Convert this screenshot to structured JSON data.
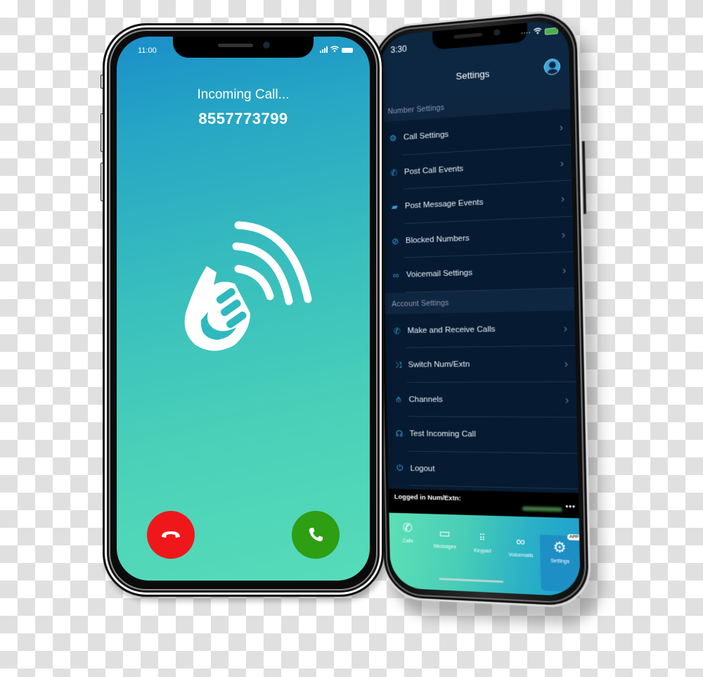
{
  "left_phone": {
    "status_time": "11:00",
    "status_icons": [
      "signal-icon",
      "wifi-icon",
      "battery-icon"
    ],
    "incoming_label": "Incoming Call...",
    "caller_number": "8557773799",
    "logo": "hand-wave-signal-logo",
    "decline_button": {
      "icon": "hang-up-icon",
      "color": "#f0171b"
    },
    "accept_button": {
      "icon": "phone-icon",
      "color": "#2e9e12"
    }
  },
  "right_phone": {
    "status_time": "3:30",
    "title": "Settings",
    "sections": [
      {
        "header": "Number Settings",
        "items": [
          {
            "label": "Call Settings",
            "icon": "gear-icon",
            "chevron": true
          },
          {
            "label": "Post Call Events",
            "icon": "phone-arrow-icon",
            "chevron": true
          },
          {
            "label": "Post Message Events",
            "icon": "message-icon",
            "chevron": true
          },
          {
            "label": "Blocked Numbers",
            "icon": "block-icon",
            "chevron": true
          },
          {
            "label": "Voicemail Settings",
            "icon": "voicemail-icon",
            "chevron": true
          }
        ]
      },
      {
        "header": "Account Settings",
        "items": [
          {
            "label": "Make and Receive Calls",
            "icon": "phone-incoming-icon",
            "chevron": true
          },
          {
            "label": "Switch Num/Extn",
            "icon": "shuffle-icon",
            "chevron": true
          },
          {
            "label": "Channels",
            "icon": "sitemap-icon",
            "chevron": true
          },
          {
            "label": "Test Incoming Call",
            "icon": "headset-icon",
            "chevron": false
          },
          {
            "label": "Logout",
            "icon": "power-icon",
            "chevron": false
          }
        ]
      }
    ],
    "logged_in_label": "Logged in Num/Extn:",
    "more_label": "•••",
    "tabs": [
      {
        "label": "Calls",
        "icon": "phone-icon",
        "active": false
      },
      {
        "label": "Messages",
        "icon": "messages-icon",
        "active": false
      },
      {
        "label": "Keypad",
        "icon": "keypad-icon",
        "active": false
      },
      {
        "label": "Voicemails",
        "icon": "voicemail-icon",
        "active": false
      },
      {
        "label": "Settings",
        "icon": "gear-icon",
        "active": true,
        "badge": "APP"
      }
    ],
    "accent_color": "#2f9fd9"
  }
}
